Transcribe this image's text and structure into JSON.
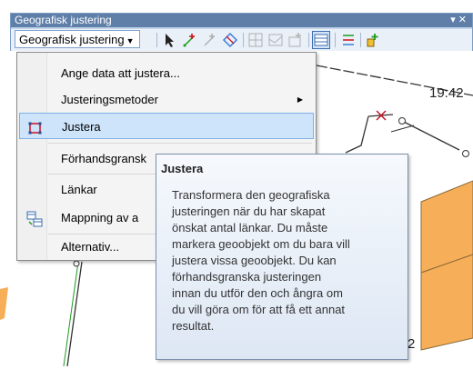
{
  "toolbar": {
    "title": "Geografisk justering",
    "window_controls": "▾ ✕",
    "dropdown_label": "Geografisk justering",
    "tools": [
      {
        "icon": "select-arrow-icon"
      },
      {
        "icon": "new-displacement-link-icon"
      },
      {
        "icon": "modify-link-icon"
      },
      {
        "icon": "multi-displacement-icon"
      },
      {
        "icon": "new-identity-link-icon"
      },
      {
        "icon": "area-of-interest-icon"
      },
      {
        "icon": "limited-adjust-icon"
      },
      {
        "icon": "view-link-table-icon"
      },
      {
        "icon": "attribute-transfer-icon"
      },
      {
        "icon": "new-link-icon"
      }
    ]
  },
  "menu": {
    "items": [
      {
        "label": "Ange data att justera...",
        "icon": ""
      },
      {
        "label": "Justeringsmetoder",
        "icon": "",
        "submenu": "▸"
      },
      {
        "label": "Justera",
        "icon": "adjust-icon",
        "highlighted": true
      },
      {
        "label": "Förhandsgransk",
        "icon": ""
      },
      {
        "label": "Länkar",
        "icon": ""
      },
      {
        "label": "Mappning av a",
        "icon": "attribute-mapping-icon"
      },
      {
        "label": "Alternativ...",
        "icon": ""
      }
    ]
  },
  "tooltip": {
    "title": "Justera",
    "body": "Transformera den geografiska\njusteringen när du har skapat\nönskat antal länkar. Du måste\nmarkera geoobjekt om du bara vill\njustera vissa geoobjekt. Du kan\nförhandsgranska justeringen\ninnan du utför den och ångra om\ndu vill göra om för att få ett annat\nresultat."
  },
  "map": {
    "labels": [
      "19:42",
      "2"
    ],
    "fill_color": "#f7ae58",
    "line_color": "#333333",
    "link_color": "#1a9c1a"
  }
}
